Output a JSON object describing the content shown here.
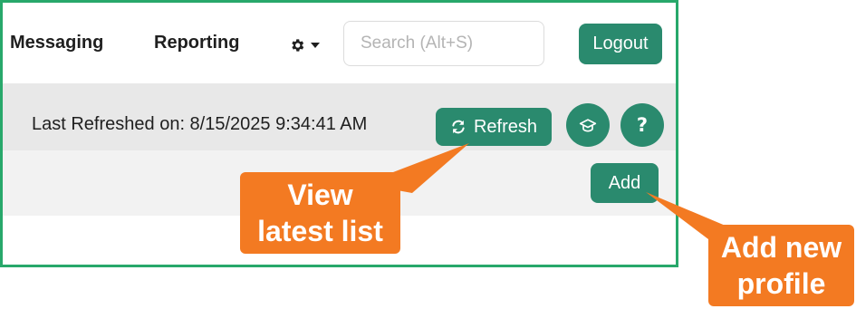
{
  "nav": {
    "messaging": "Messaging",
    "reporting": "Reporting",
    "settings_icon": "gear-icon",
    "dropdown_icon": "caret-down-icon"
  },
  "search": {
    "placeholder": "Search (Alt+S)",
    "value": ""
  },
  "logout_label": "Logout",
  "toolbar": {
    "last_refreshed": "Last Refreshed on: 8/15/2025 9:34:41 AM",
    "refresh_label": "Refresh",
    "refresh_icon": "refresh-icon",
    "learn_icon": "graduation-cap-icon",
    "help_label": "?"
  },
  "add_label": "Add",
  "callouts": {
    "refresh_line1": "View",
    "refresh_line2": "latest list",
    "add_line1": "Add new",
    "add_line2": "profile"
  },
  "colors": {
    "frame_border": "#28a86b",
    "button_green": "#2a8a6e",
    "callout_orange": "#f37a22",
    "band_gray": "#e8e8e8",
    "band_light": "#f2f2f2"
  }
}
